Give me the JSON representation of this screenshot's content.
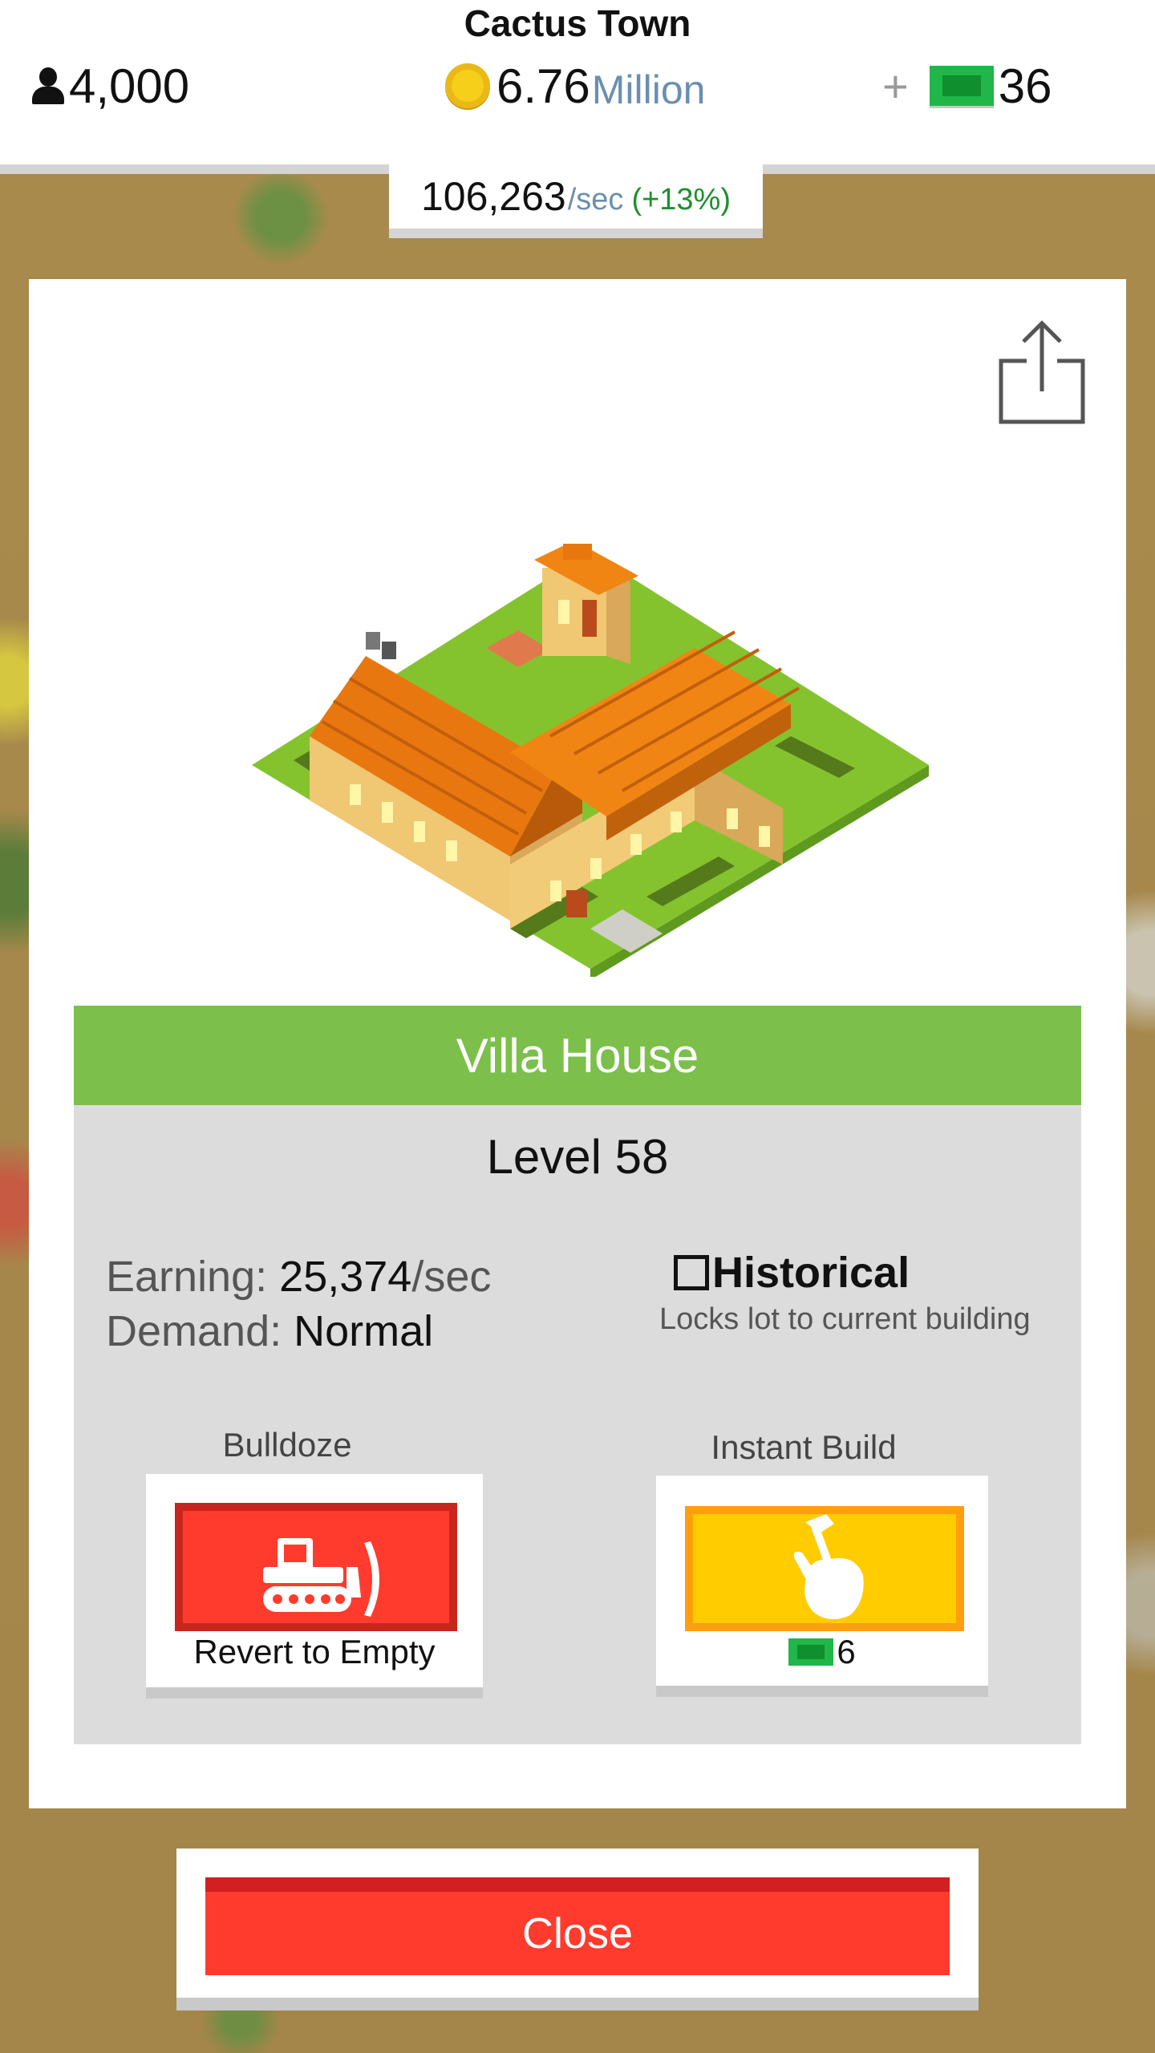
{
  "header": {
    "town_name": "Cactus Town",
    "population": "4,000",
    "money_value": "6.76",
    "money_unit": "Million",
    "plus": "+",
    "cash": "36",
    "rate_value": "106,263",
    "rate_unit": "/sec",
    "rate_bonus": "(+13%)"
  },
  "panel": {
    "share_icon": "share-icon",
    "building_name": "Villa House",
    "level": "Level 58",
    "earning_label": "Earning:",
    "earning_value": "25,374",
    "earning_unit": "/sec",
    "demand_label": "Demand:",
    "demand_value": "Normal",
    "historical_checked": false,
    "historical_label": "Historical",
    "historical_note": "Locks lot to current building",
    "bulldoze_caption": "Bulldoze",
    "bulldoze_label": "Revert to Empty",
    "instant_caption": "Instant Build",
    "instant_cost": "6"
  },
  "close_label": "Close",
  "colors": {
    "banner_green": "#7cbf4b",
    "bulldoze_red": "#ff3b2e",
    "instant_yellow": "#ffcc00",
    "cash_green": "#20b64a"
  }
}
